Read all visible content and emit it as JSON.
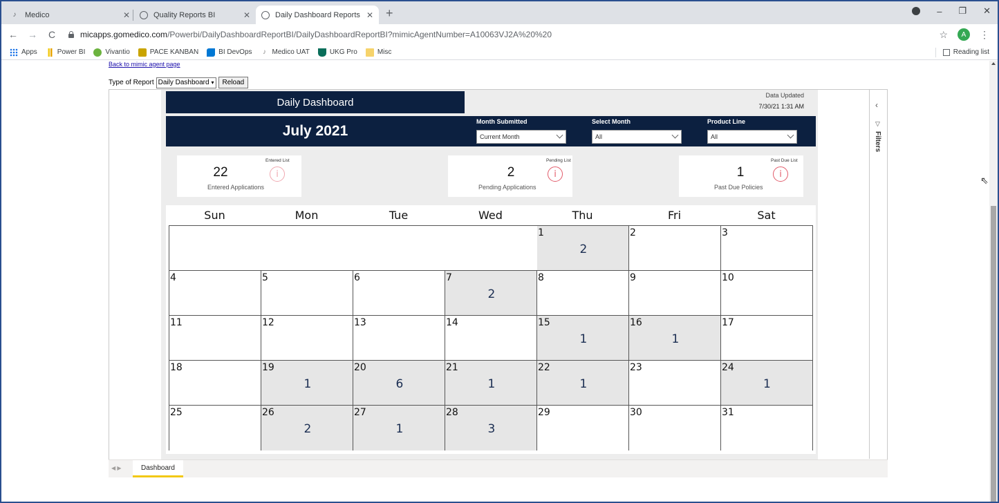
{
  "browser": {
    "tabs": [
      {
        "title": "Medico",
        "favicon": "medico-icon",
        "active": false
      },
      {
        "title": "Quality Reports BI",
        "favicon": "globe-icon",
        "active": false
      },
      {
        "title": "Daily Dashboard Reports BI",
        "favicon": "globe-icon",
        "active": true
      }
    ],
    "new_tab": "+",
    "url_host": "micapps.gomedico.com",
    "url_path": "/Powerbi/DailyDashboardReportBI/DailyDashboardReportBI?mimicAgentNumber=A10063VJ2A%20%20",
    "avatar_letter": "A",
    "bookmarks": [
      {
        "label": "Apps",
        "icon": "apps-grid-icon",
        "color": "#1a73e8"
      },
      {
        "label": "Power BI",
        "icon": "powerbi-icon",
        "color": "#f2c811"
      },
      {
        "label": "Vivantio",
        "icon": "vivantio-icon",
        "color": "#6cb33f"
      },
      {
        "label": "PACE KANBAN",
        "icon": "kanban-icon",
        "color": "#c9a400"
      },
      {
        "label": "BI DevOps",
        "icon": "devops-icon",
        "color": "#0078d4"
      },
      {
        "label": "Medico UAT",
        "icon": "medico-icon",
        "color": "#888888"
      },
      {
        "label": "UKG Pro",
        "icon": "ukg-icon",
        "color": "#0a6e5a"
      },
      {
        "label": "Misc",
        "icon": "folder-icon",
        "color": "#f6d36b"
      }
    ],
    "reading_list": "Reading list"
  },
  "page": {
    "back_link": "Back to mimic agent page",
    "report_type_label": "Type of Report",
    "report_type_value": "Daily Dashboard",
    "reload_label": "Reload"
  },
  "report": {
    "title": "Daily Dashboard",
    "data_updated_label": "Data Updated",
    "data_updated_value": "7/30/21 1:31 AM",
    "month_title": "July 2021",
    "slicers": [
      {
        "label": "Month Submitted",
        "value": "Current Month"
      },
      {
        "label": "Select Month",
        "value": "All"
      },
      {
        "label": "Product Line",
        "value": "All"
      }
    ],
    "cards": [
      {
        "link": "Entered List",
        "value": "22",
        "desc": "Entered Applications"
      },
      {
        "link": "Pending List",
        "value": "2",
        "desc": "Pending Applications"
      },
      {
        "link": "Past Due List",
        "value": "1",
        "desc": "Past Due Policies"
      }
    ],
    "info_glyph": "i",
    "weekdays": [
      "Sun",
      "Mon",
      "Tue",
      "Wed",
      "Thu",
      "Fri",
      "Sat"
    ],
    "calendar_first_weekday": 4,
    "calendar_days": 31,
    "day_counts": {
      "1": "2",
      "7": "2",
      "15": "1",
      "16": "1",
      "19": "1",
      "20": "6",
      "21": "1",
      "22": "1",
      "24": "1",
      "26": "2",
      "27": "1",
      "28": "3"
    },
    "filters_label": "Filters",
    "page_tab": "Dashboard"
  },
  "colors": {
    "navy": "#0c2040",
    "highlight_cell": "#e6e6e6",
    "info_red": "#e25c6b",
    "tab_accent": "#f2c811"
  }
}
